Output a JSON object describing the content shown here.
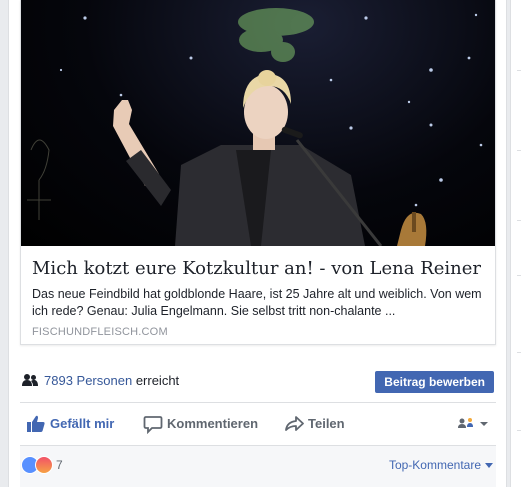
{
  "link_preview": {
    "headline": "Mich kotzt eure Kotzkultur an! - von Lena Reiner",
    "description": "Das neue Feindbild hat goldblonde Haare, ist 25 Jahre alt und weiblich. Von wem ich rede? Genau: Julia Engelmann. Sie selbst tritt non-chalante ...",
    "domain": "FISCHUNDFLEISCH.COM"
  },
  "reach": {
    "count": "7893 Personen",
    "suffix": "erreicht",
    "boost_label": "Beitrag bewerben"
  },
  "actions": {
    "like_label": "Gefällt mir",
    "comment_label": "Kommentieren",
    "share_label": "Teilen"
  },
  "reactions": {
    "count": "7",
    "sort_label": "Top-Kommentare"
  },
  "colors": {
    "brand": "#4267b2",
    "link": "#365899",
    "muted": "#606770"
  }
}
